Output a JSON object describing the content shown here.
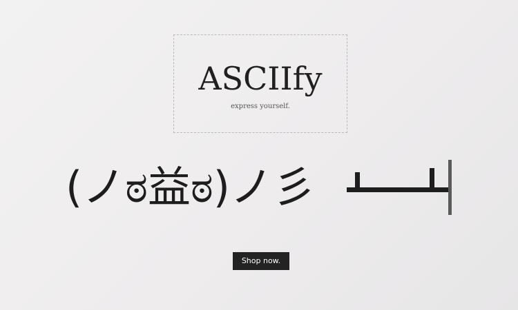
{
  "logo": {
    "title": "ASCIIfy",
    "tagline": "express yourself."
  },
  "hero": {
    "kaomoji": "(ノಠ益ಠ)ノ彡┻━┻"
  },
  "cta": {
    "label": "Shop now."
  },
  "colors": {
    "button_bg": "#232323",
    "text": "#1d1d1d",
    "background": "#efeeee"
  }
}
